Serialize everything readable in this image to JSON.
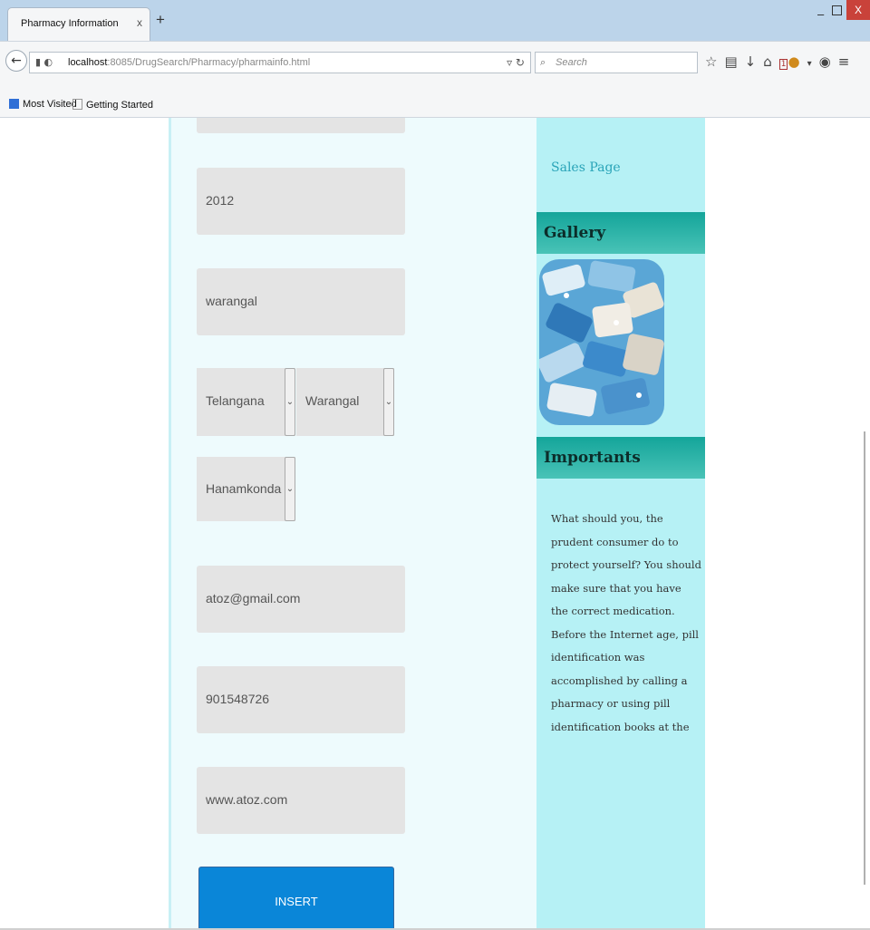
{
  "browser": {
    "tab_title": "Pharmacy Information",
    "tab_close": "x",
    "new_tab": "+",
    "window_close": "X",
    "url_host": "localhost",
    "url_rest": ":8085/DrugSearch/Pharmacy/pharmainfo.html",
    "search_placeholder": "Search",
    "notification_count": "1",
    "bookmarks": [
      "Most Visited",
      "Getting Started"
    ]
  },
  "form": {
    "fields": [
      {
        "value": ""
      },
      {
        "value": "2012"
      },
      {
        "value": "warangal"
      }
    ],
    "state_select": "Telangana",
    "district_select": "Warangal",
    "mandal_select": "Hanamkonda",
    "email": "atoz@gmail.com",
    "phone": "901548726",
    "website": "www.atoz.com",
    "insert_label": "INSERT"
  },
  "sidebar": {
    "sales_link": "Sales Page",
    "gallery_heading": "Gallery",
    "importants_heading": "Importants",
    "importants_text": "What should you, the prudent consumer do to protect yourself? You should make sure that you have the correct medication. Before the Internet age, pill identification was accomplished by calling a pharmacy or using pill identification books at the"
  }
}
